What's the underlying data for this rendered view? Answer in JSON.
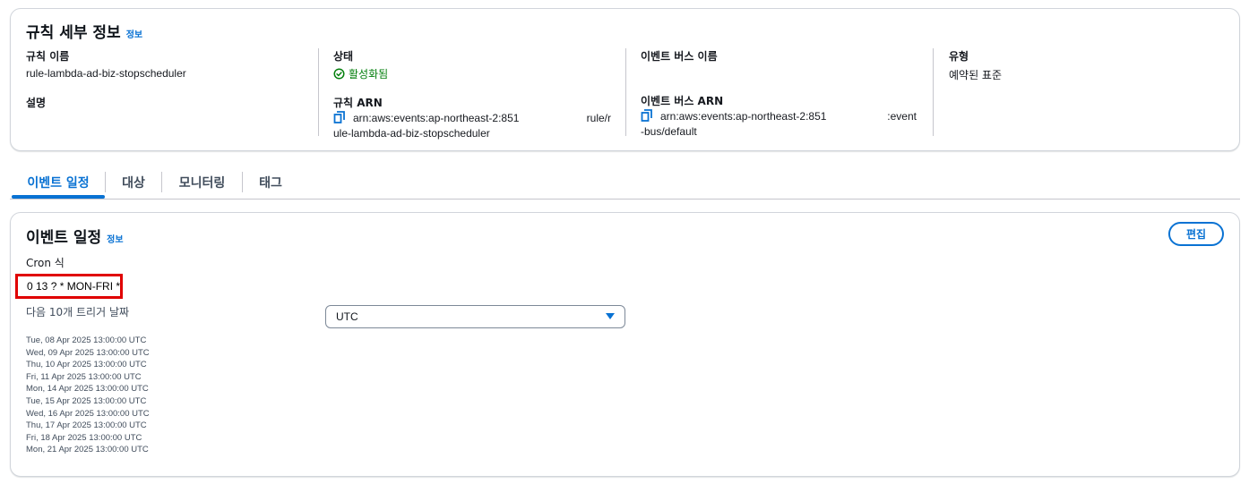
{
  "details": {
    "title": "규칙 세부 정보",
    "info_link": "정보",
    "rule_name_label": "규칙 이름",
    "rule_name": "rule-lambda-ad-biz-stopscheduler",
    "description_label": "설명",
    "status_label": "상태",
    "status_value": "활성화됨",
    "rule_arn_label": "규칙 ARN",
    "rule_arn_line1_a": "arn:aws:events:ap-northeast-2:851",
    "rule_arn_line1_b": "rule/r",
    "rule_arn_line2": "ule-lambda-ad-biz-stopscheduler",
    "event_bus_name_label": "이벤트 버스 이름",
    "event_bus_arn_label": "이벤트 버스 ARN",
    "event_bus_arn_line1_a": "arn:aws:events:ap-northeast-2:851",
    "event_bus_arn_line1_b": ":event",
    "event_bus_arn_line2": "-bus/default",
    "type_label": "유형",
    "type_value": "예약된 표준"
  },
  "tabs": [
    {
      "label": "이벤트 일정",
      "active": true
    },
    {
      "label": "대상",
      "active": false
    },
    {
      "label": "모니터링",
      "active": false
    },
    {
      "label": "태그",
      "active": false
    }
  ],
  "schedule": {
    "title": "이벤트 일정",
    "info_link": "정보",
    "edit_label": "편집",
    "cron_label": "Cron 식",
    "cron_value": "0 13 ? * MON-FRI *",
    "next_label": "다음 10개 트리거 날짜",
    "timezone": "UTC",
    "dates": [
      "Tue, 08 Apr 2025 13:00:00 UTC",
      "Wed, 09 Apr 2025 13:00:00 UTC",
      "Thu, 10 Apr 2025 13:00:00 UTC",
      "Fri, 11 Apr 2025 13:00:00 UTC",
      "Mon, 14 Apr 2025 13:00:00 UTC",
      "Tue, 15 Apr 2025 13:00:00 UTC",
      "Wed, 16 Apr 2025 13:00:00 UTC",
      "Thu, 17 Apr 2025 13:00:00 UTC",
      "Fri, 18 Apr 2025 13:00:00 UTC",
      "Mon, 21 Apr 2025 13:00:00 UTC"
    ]
  },
  "colors": {
    "accent": "#0972d3",
    "success": "#037f0c",
    "highlight_border": "#e00000"
  },
  "icons": {
    "status": "check-circle-icon",
    "copy": "copy-icon",
    "select": "caret-down-icon"
  }
}
